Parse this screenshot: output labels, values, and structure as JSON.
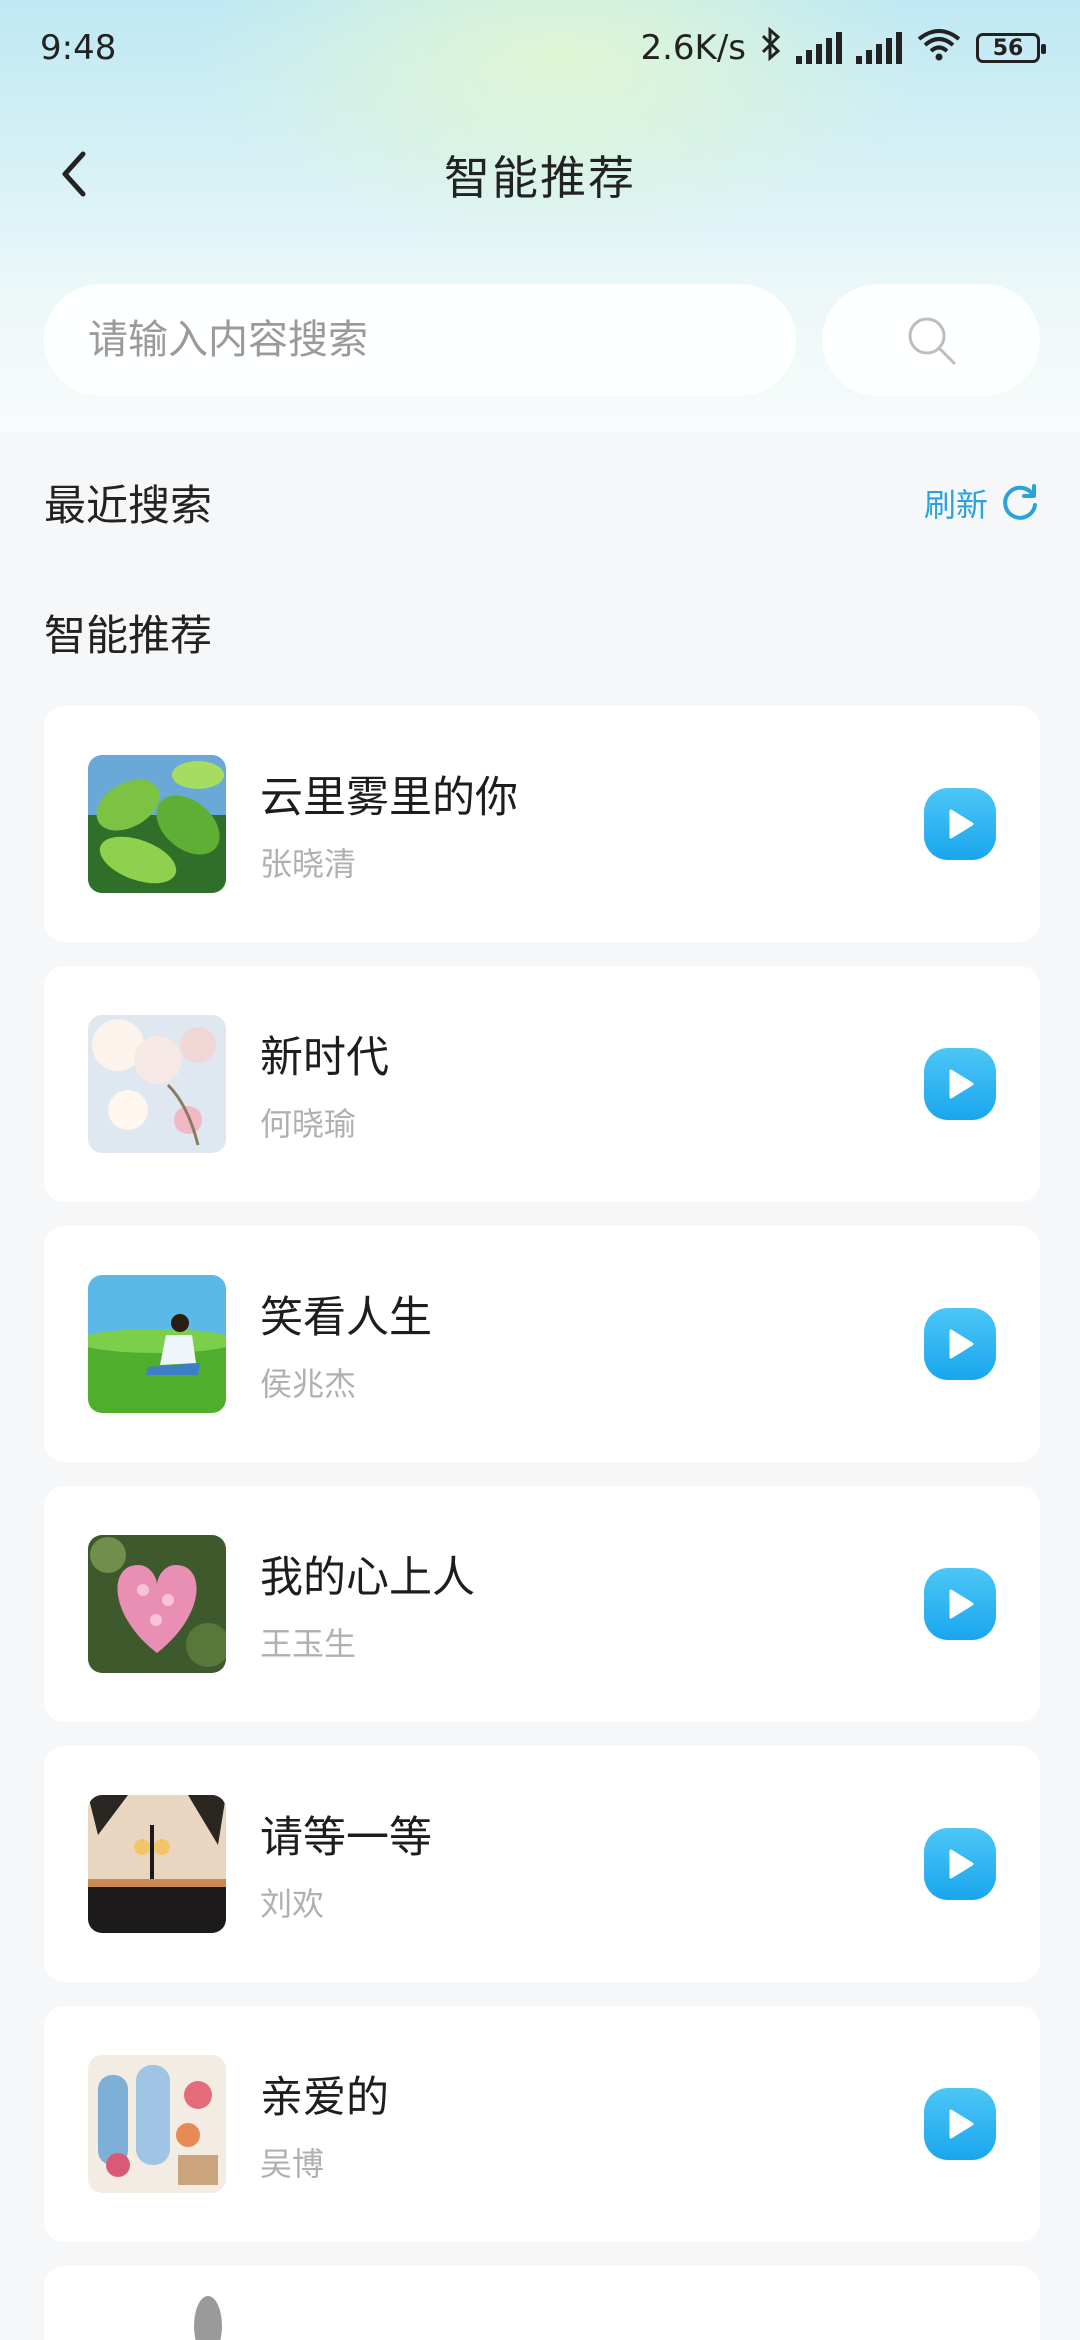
{
  "status": {
    "time": "9:48",
    "speed": "2.6K/s",
    "battery": "56"
  },
  "header": {
    "title": "智能推荐"
  },
  "search": {
    "placeholder": "请输入内容搜索"
  },
  "recent": {
    "title": "最近搜索",
    "refresh_label": "刷新"
  },
  "recommend": {
    "title": "智能推荐",
    "items": [
      {
        "title": "云里雾里的你",
        "artist": "张晓清",
        "cover": "leaves"
      },
      {
        "title": "新时代",
        "artist": "何晓瑜",
        "cover": "blossom"
      },
      {
        "title": "笑看人生",
        "artist": "侯兆杰",
        "cover": "meadow"
      },
      {
        "title": "我的心上人",
        "artist": "王玉生",
        "cover": "heart-flowers"
      },
      {
        "title": "请等一等",
        "artist": "刘欢",
        "cover": "street-lamp"
      },
      {
        "title": "亲爱的",
        "artist": "吴博",
        "cover": "painted-window"
      }
    ]
  },
  "colors": {
    "accent": "#2aa3dd",
    "play": "#1fb0f0"
  }
}
